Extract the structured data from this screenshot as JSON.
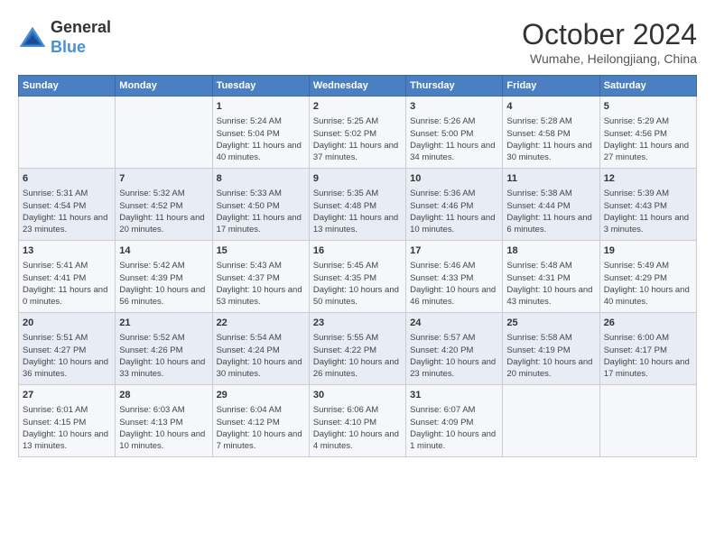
{
  "logo": {
    "general": "General",
    "blue": "Blue"
  },
  "header": {
    "month": "October 2024",
    "location": "Wumahe, Heilongjiang, China"
  },
  "days_of_week": [
    "Sunday",
    "Monday",
    "Tuesday",
    "Wednesday",
    "Thursday",
    "Friday",
    "Saturday"
  ],
  "weeks": [
    [
      {
        "day": "",
        "info": ""
      },
      {
        "day": "",
        "info": ""
      },
      {
        "day": "1",
        "info": "Sunrise: 5:24 AM\nSunset: 5:04 PM\nDaylight: 11 hours and 40 minutes."
      },
      {
        "day": "2",
        "info": "Sunrise: 5:25 AM\nSunset: 5:02 PM\nDaylight: 11 hours and 37 minutes."
      },
      {
        "day": "3",
        "info": "Sunrise: 5:26 AM\nSunset: 5:00 PM\nDaylight: 11 hours and 34 minutes."
      },
      {
        "day": "4",
        "info": "Sunrise: 5:28 AM\nSunset: 4:58 PM\nDaylight: 11 hours and 30 minutes."
      },
      {
        "day": "5",
        "info": "Sunrise: 5:29 AM\nSunset: 4:56 PM\nDaylight: 11 hours and 27 minutes."
      }
    ],
    [
      {
        "day": "6",
        "info": "Sunrise: 5:31 AM\nSunset: 4:54 PM\nDaylight: 11 hours and 23 minutes."
      },
      {
        "day": "7",
        "info": "Sunrise: 5:32 AM\nSunset: 4:52 PM\nDaylight: 11 hours and 20 minutes."
      },
      {
        "day": "8",
        "info": "Sunrise: 5:33 AM\nSunset: 4:50 PM\nDaylight: 11 hours and 17 minutes."
      },
      {
        "day": "9",
        "info": "Sunrise: 5:35 AM\nSunset: 4:48 PM\nDaylight: 11 hours and 13 minutes."
      },
      {
        "day": "10",
        "info": "Sunrise: 5:36 AM\nSunset: 4:46 PM\nDaylight: 11 hours and 10 minutes."
      },
      {
        "day": "11",
        "info": "Sunrise: 5:38 AM\nSunset: 4:44 PM\nDaylight: 11 hours and 6 minutes."
      },
      {
        "day": "12",
        "info": "Sunrise: 5:39 AM\nSunset: 4:43 PM\nDaylight: 11 hours and 3 minutes."
      }
    ],
    [
      {
        "day": "13",
        "info": "Sunrise: 5:41 AM\nSunset: 4:41 PM\nDaylight: 11 hours and 0 minutes."
      },
      {
        "day": "14",
        "info": "Sunrise: 5:42 AM\nSunset: 4:39 PM\nDaylight: 10 hours and 56 minutes."
      },
      {
        "day": "15",
        "info": "Sunrise: 5:43 AM\nSunset: 4:37 PM\nDaylight: 10 hours and 53 minutes."
      },
      {
        "day": "16",
        "info": "Sunrise: 5:45 AM\nSunset: 4:35 PM\nDaylight: 10 hours and 50 minutes."
      },
      {
        "day": "17",
        "info": "Sunrise: 5:46 AM\nSunset: 4:33 PM\nDaylight: 10 hours and 46 minutes."
      },
      {
        "day": "18",
        "info": "Sunrise: 5:48 AM\nSunset: 4:31 PM\nDaylight: 10 hours and 43 minutes."
      },
      {
        "day": "19",
        "info": "Sunrise: 5:49 AM\nSunset: 4:29 PM\nDaylight: 10 hours and 40 minutes."
      }
    ],
    [
      {
        "day": "20",
        "info": "Sunrise: 5:51 AM\nSunset: 4:27 PM\nDaylight: 10 hours and 36 minutes."
      },
      {
        "day": "21",
        "info": "Sunrise: 5:52 AM\nSunset: 4:26 PM\nDaylight: 10 hours and 33 minutes."
      },
      {
        "day": "22",
        "info": "Sunrise: 5:54 AM\nSunset: 4:24 PM\nDaylight: 10 hours and 30 minutes."
      },
      {
        "day": "23",
        "info": "Sunrise: 5:55 AM\nSunset: 4:22 PM\nDaylight: 10 hours and 26 minutes."
      },
      {
        "day": "24",
        "info": "Sunrise: 5:57 AM\nSunset: 4:20 PM\nDaylight: 10 hours and 23 minutes."
      },
      {
        "day": "25",
        "info": "Sunrise: 5:58 AM\nSunset: 4:19 PM\nDaylight: 10 hours and 20 minutes."
      },
      {
        "day": "26",
        "info": "Sunrise: 6:00 AM\nSunset: 4:17 PM\nDaylight: 10 hours and 17 minutes."
      }
    ],
    [
      {
        "day": "27",
        "info": "Sunrise: 6:01 AM\nSunset: 4:15 PM\nDaylight: 10 hours and 13 minutes."
      },
      {
        "day": "28",
        "info": "Sunrise: 6:03 AM\nSunset: 4:13 PM\nDaylight: 10 hours and 10 minutes."
      },
      {
        "day": "29",
        "info": "Sunrise: 6:04 AM\nSunset: 4:12 PM\nDaylight: 10 hours and 7 minutes."
      },
      {
        "day": "30",
        "info": "Sunrise: 6:06 AM\nSunset: 4:10 PM\nDaylight: 10 hours and 4 minutes."
      },
      {
        "day": "31",
        "info": "Sunrise: 6:07 AM\nSunset: 4:09 PM\nDaylight: 10 hours and 1 minute."
      },
      {
        "day": "",
        "info": ""
      },
      {
        "day": "",
        "info": ""
      }
    ]
  ]
}
